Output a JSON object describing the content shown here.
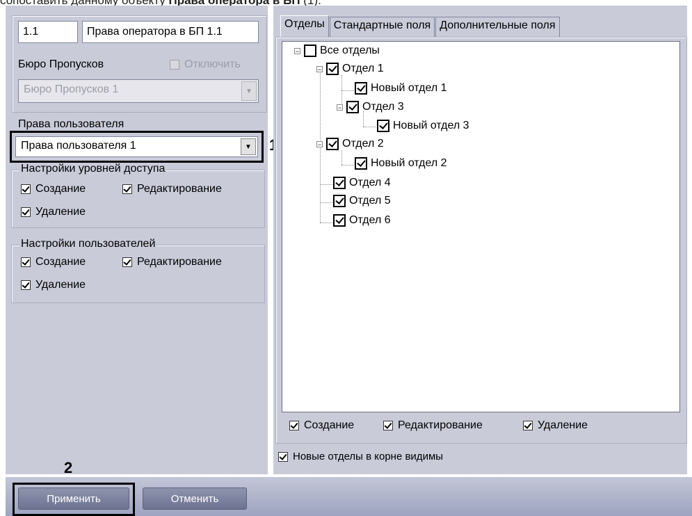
{
  "caption": {
    "prefix": "сопоставить данному объекту ",
    "bold": "Права оператора в БП",
    "suffix": " (1)."
  },
  "left": {
    "id_field": "1.1",
    "name_field": "Права оператора в БП 1.1",
    "bureau_label": "Бюро Пропусков",
    "disable_label": "Отключить",
    "bureau_combo": "Бюро Пропусков 1",
    "user_rights_label": "Права пользователя",
    "user_rights_combo": "Права пользователя 1",
    "access_group": {
      "title": "Настройки уровней доступа",
      "create": "Создание",
      "edit": "Редактирование",
      "delete": "Удаление"
    },
    "users_group": {
      "title": "Настройки пользователей",
      "create": "Создание",
      "edit": "Редактирование",
      "delete": "Удаление"
    }
  },
  "tabs": [
    "Отделы",
    "Стандартные поля",
    "Дополнительные поля"
  ],
  "tree": {
    "root": "Все отделы",
    "dep1": "Отдел 1",
    "new1": "Новый отдел 1",
    "dep3": "Отдел 3",
    "new3": "Новый отдел 3",
    "dep2": "Отдел 2",
    "new2": "Новый отдел 2",
    "dep4": "Отдел 4",
    "dep5": "Отдел 5",
    "dep6": "Отдел 6"
  },
  "perm_row": {
    "create": "Создание",
    "edit": "Редактирование",
    "delete": "Удаление"
  },
  "root_visible": "Новые отделы в корне видимы",
  "markers": {
    "m1": "1",
    "m2": "2"
  },
  "buttons": {
    "apply": "Применить",
    "cancel": "Отменить"
  }
}
